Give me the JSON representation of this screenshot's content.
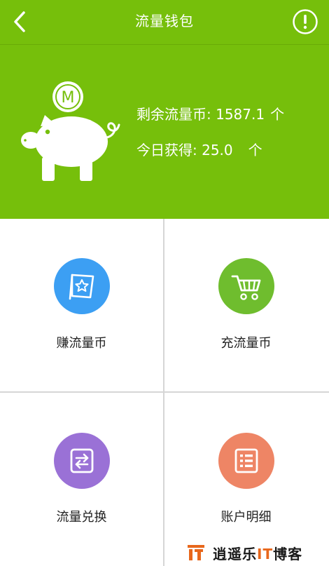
{
  "header": {
    "title": "流量钱包",
    "back_icon": "chevron-left-icon",
    "info_icon": "exclamation-circle-icon"
  },
  "summary": {
    "coin_letter": "M",
    "balance_label": "剩余流量币: 1587.1",
    "balance_unit": "个",
    "today_label": "今日获得: 25.0",
    "today_unit": "个"
  },
  "tiles": [
    {
      "label": "赚流量币",
      "icon": "flag-star-icon",
      "color": "#3c9ff3"
    },
    {
      "label": "充流量币",
      "icon": "cart-icon",
      "color": "#6fbd2e"
    },
    {
      "label": "流量兑换",
      "icon": "exchange-icon",
      "color": "#9a71d6"
    },
    {
      "label": "账户明细",
      "icon": "list-document-icon",
      "color": "#ee8565"
    }
  ],
  "watermark": {
    "text_start": "逍遥乐",
    "text_accent": "IT",
    "text_end": "博客"
  },
  "colors": {
    "brand_green": "#76bf0b",
    "divider": "#d6d6d6"
  }
}
